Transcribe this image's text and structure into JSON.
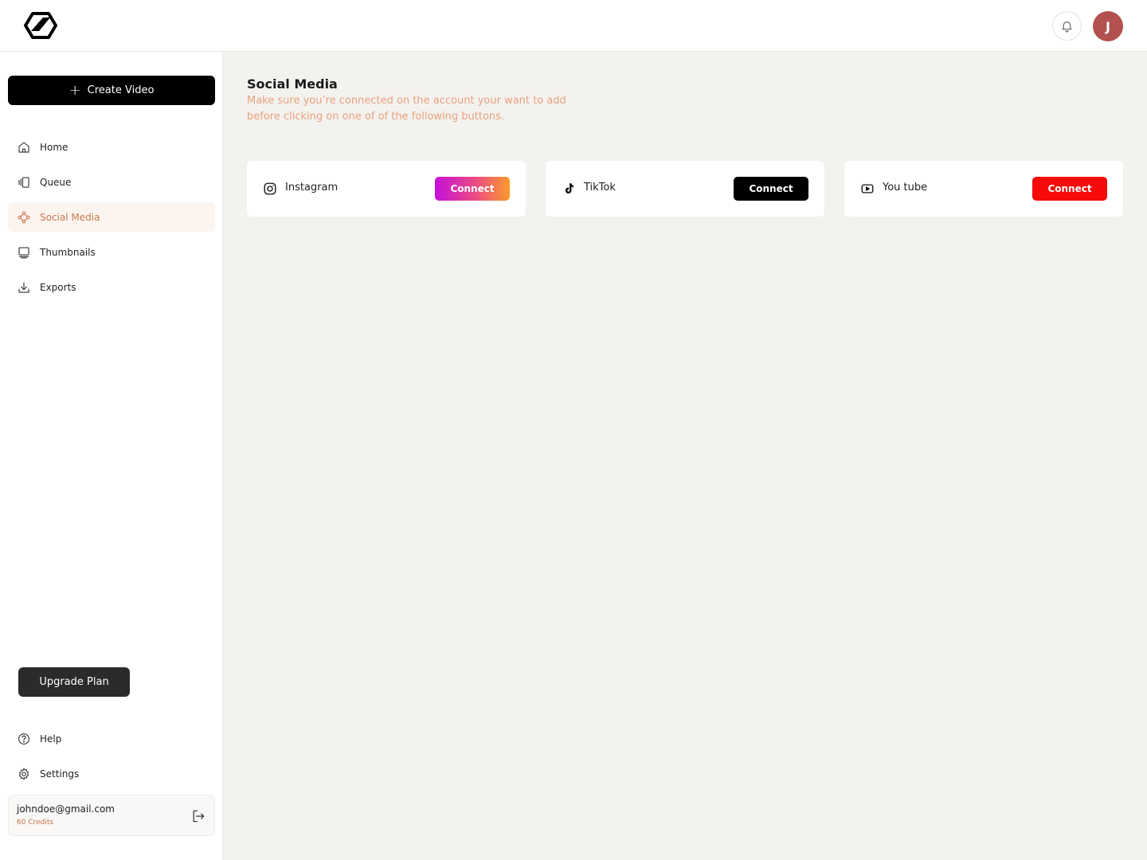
{
  "header": {
    "logo_icon": "hexagon-check-logo-icon",
    "notification_icon": "bell-icon",
    "avatar_initial": "J",
    "avatar_color": "#b2514f"
  },
  "sidebar": {
    "create_label": "Create Video",
    "items": [
      {
        "label": "Home",
        "icon": "home-icon"
      },
      {
        "label": "Queue",
        "icon": "queue-icon"
      },
      {
        "label": "Social Media",
        "icon": "social-share-icon",
        "active": true
      },
      {
        "label": "Thumbnails",
        "icon": "thumbnails-icon"
      },
      {
        "label": "Exports",
        "icon": "download-icon"
      }
    ],
    "upgrade_label": "Upgrade Plan",
    "bottom_items": [
      {
        "label": "Help",
        "icon": "help-circle-icon"
      },
      {
        "label": "Settings",
        "icon": "gear-icon"
      }
    ],
    "account": {
      "email": "johndoe@gmail.com",
      "credits": "60 Credits"
    }
  },
  "main": {
    "title": "Social Media",
    "subtitle": "Make sure you’re connected on the account your want to add before clicking on one of of the following buttons.",
    "platforms": [
      {
        "name": "Instagram",
        "icon": "instagram-icon",
        "connect_label": "Connect",
        "button_color": "gradient #c50fd9→#fb9b2a"
      },
      {
        "name": "TikTok",
        "icon": "tiktok-icon",
        "connect_label": "Connect",
        "button_color": "#000000"
      },
      {
        "name": "You tube",
        "icon": "youtube-icon",
        "connect_label": "Connect",
        "button_color": "#f70a0a"
      }
    ]
  },
  "colors": {
    "accent": "#c8774d",
    "background": "#f4f2ef"
  }
}
